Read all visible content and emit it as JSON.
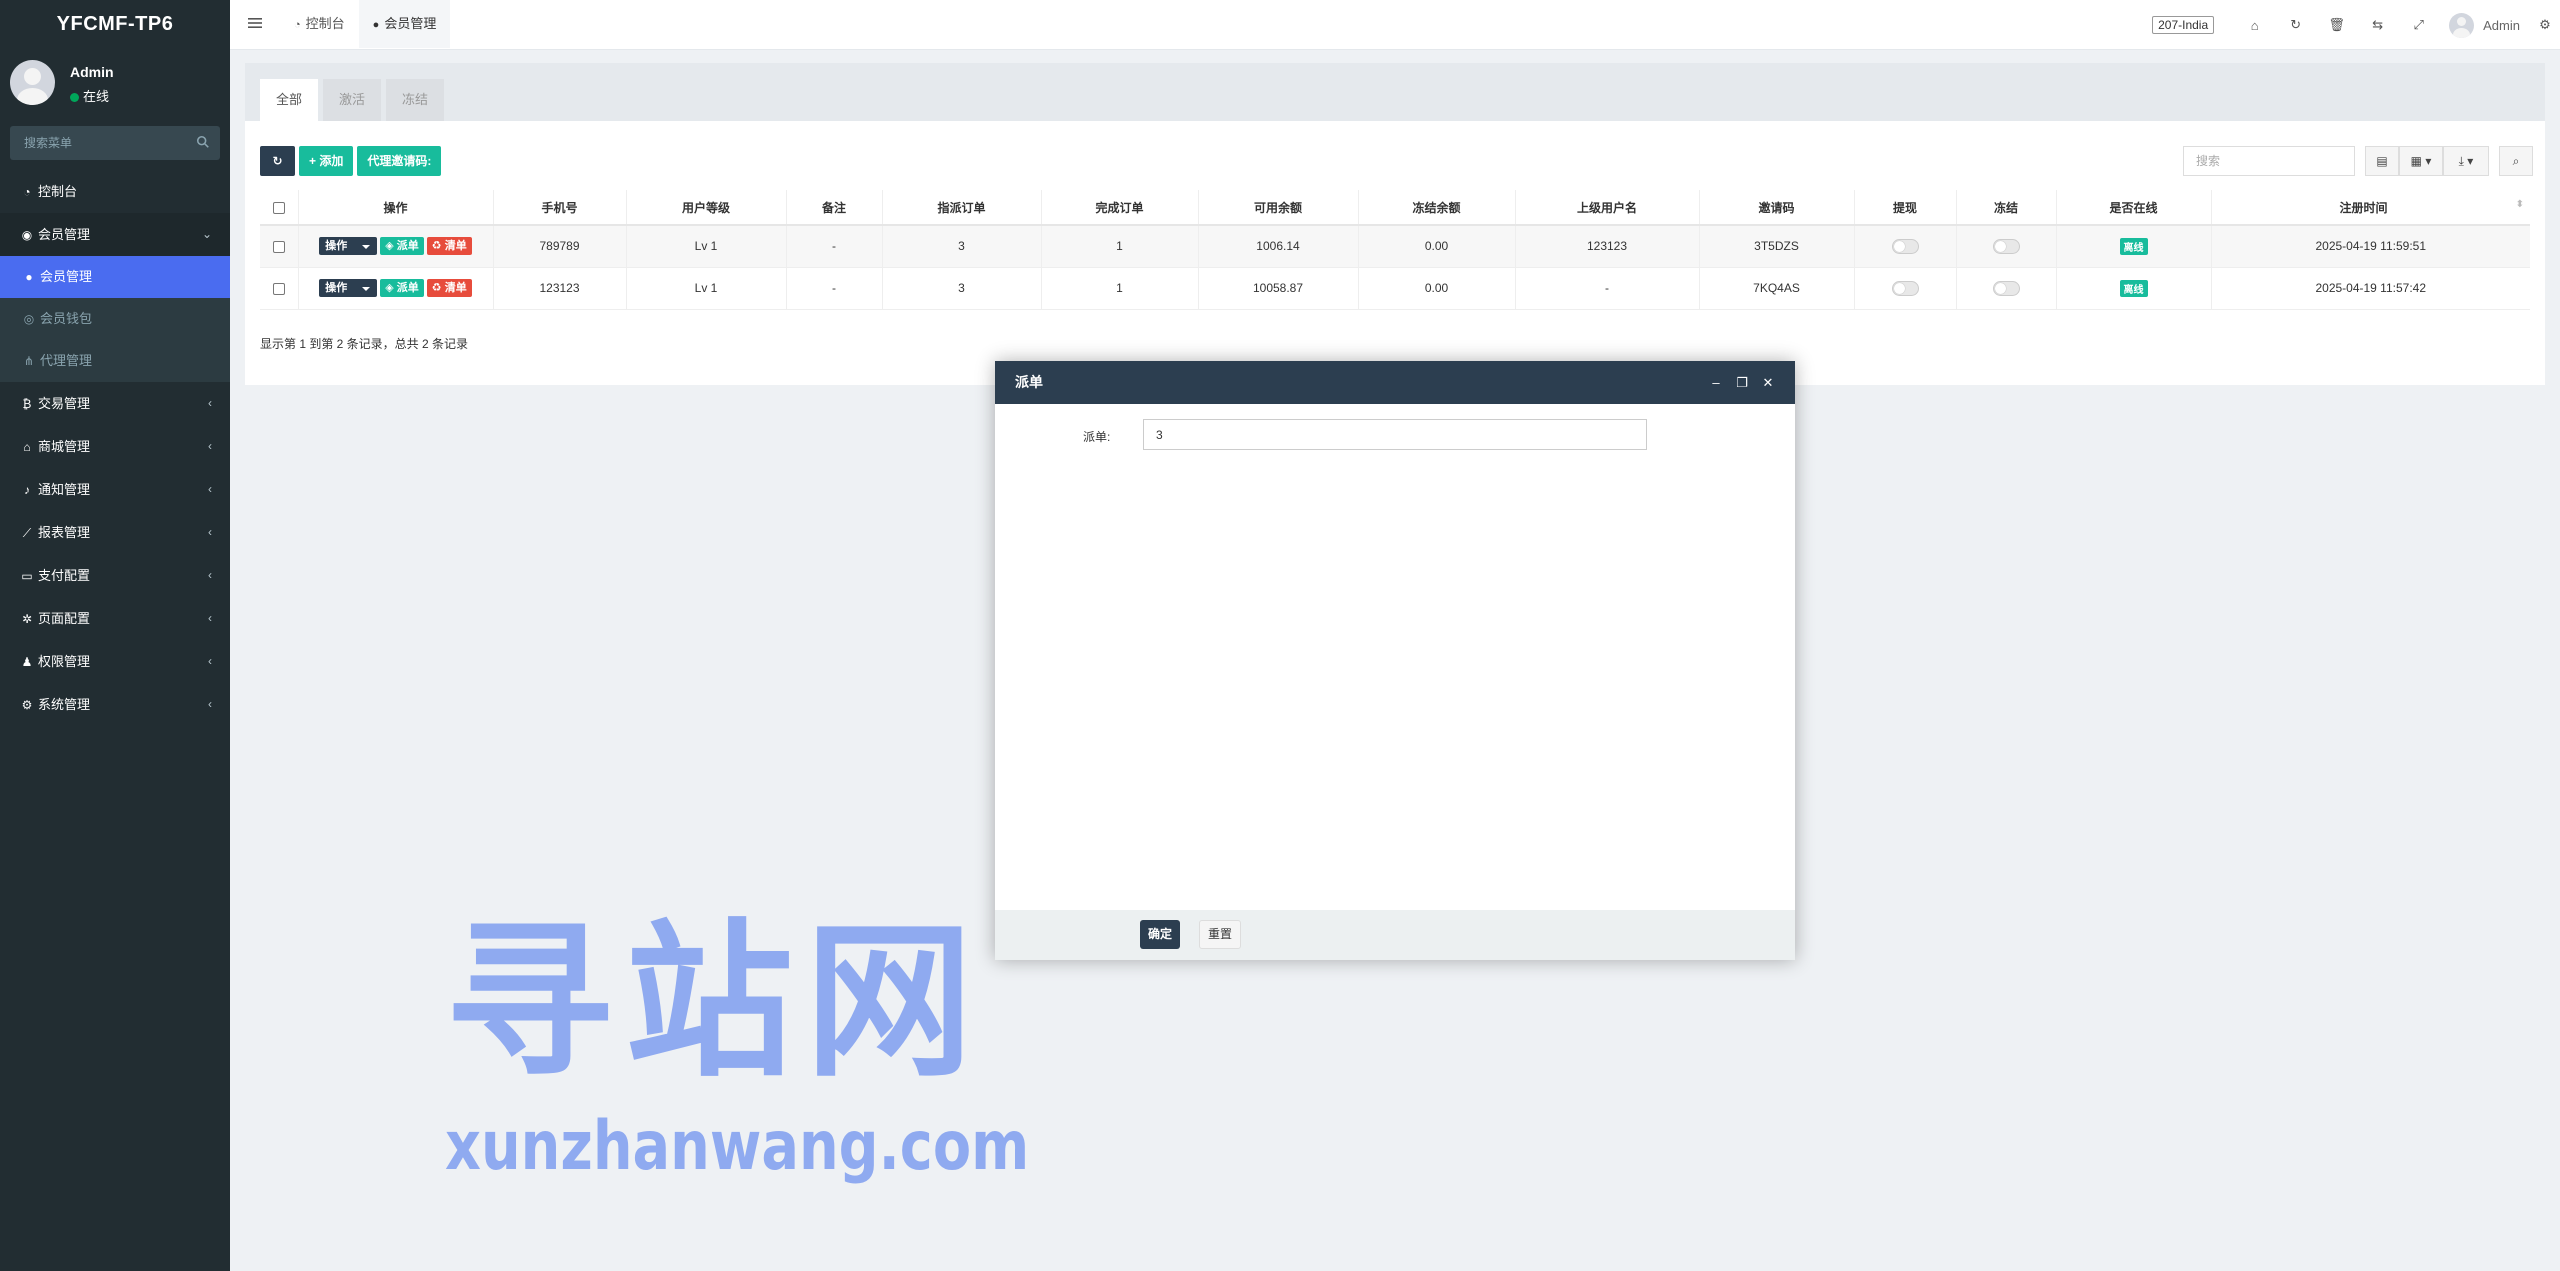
{
  "app": {
    "logo": "YFCMF-TP6",
    "user_name": "Admin",
    "user_status": "在线",
    "search_placeholder": "搜索菜单"
  },
  "sidebar": {
    "items": [
      {
        "label": "控制台",
        "icon": "dashboard-icon"
      },
      {
        "label": "会员管理",
        "icon": "user-circle-icon",
        "open": true
      },
      {
        "label": "交易管理",
        "icon": "bitcoin-icon"
      },
      {
        "label": "商城管理",
        "icon": "home-icon"
      },
      {
        "label": "通知管理",
        "icon": "bell-icon"
      },
      {
        "label": "报表管理",
        "icon": "line-chart-icon"
      },
      {
        "label": "支付配置",
        "icon": "credit-card-icon"
      },
      {
        "label": "页面配置",
        "icon": "gear-icon"
      },
      {
        "label": "权限管理",
        "icon": "users-icon"
      },
      {
        "label": "系统管理",
        "icon": "gears-icon"
      }
    ],
    "submenu": [
      {
        "label": "会员管理",
        "icon": "user-icon",
        "active": true
      },
      {
        "label": "会员钱包",
        "icon": "circle-icon"
      },
      {
        "label": "代理管理",
        "icon": "sitemap-icon"
      }
    ]
  },
  "topbar": {
    "tabs": [
      {
        "label": "控制台",
        "icon": "dashboard-icon"
      },
      {
        "label": "会员管理",
        "icon": "user-icon"
      }
    ],
    "lang": "207-India",
    "user": "Admin"
  },
  "panel": {
    "tabs": [
      "全部",
      "激活",
      "冻结"
    ],
    "buttons": {
      "add": "添加",
      "invite": "代理邀请码:"
    },
    "search_placeholder": "搜索",
    "columns": [
      "操作",
      "手机号",
      "用户等级",
      "备注",
      "指派订单",
      "完成订单",
      "可用余额",
      "冻结余额",
      "上级用户名",
      "邀请码",
      "提现",
      "冻结",
      "是否在线",
      "注册时间"
    ],
    "op_labels": {
      "action": "操作",
      "dispatch": "派单",
      "clear": "清单"
    },
    "rows": [
      {
        "phone": "789789",
        "level": "Lv 1",
        "note": "-",
        "assigned": "3",
        "done": "1",
        "balance": "1006.14",
        "frozen": "0.00",
        "parent": "123123",
        "code": "3T5DZS",
        "online": "离线",
        "time": "2025-04-19 11:59:51"
      },
      {
        "phone": "123123",
        "level": "Lv 1",
        "note": "-",
        "assigned": "3",
        "done": "1",
        "balance": "10058.87",
        "frozen": "0.00",
        "parent": "-",
        "code": "7KQ4AS",
        "online": "离线",
        "time": "2025-04-19 11:57:42"
      }
    ],
    "footer": "显示第 1 到第 2 条记录，总共 2 条记录"
  },
  "modal": {
    "title": "派单",
    "field_label": "派单:",
    "field_value": "3",
    "ok": "确定",
    "reset": "重置"
  },
  "watermark": {
    "cn": "寻站网",
    "en": "xunzhanwang.com"
  },
  "colors": {
    "sidebar_bg": "#222d32",
    "accent_active": "#4a6cf0",
    "green": "#18bc9c",
    "red": "#e74c3c",
    "dark": "#2c3e50"
  }
}
